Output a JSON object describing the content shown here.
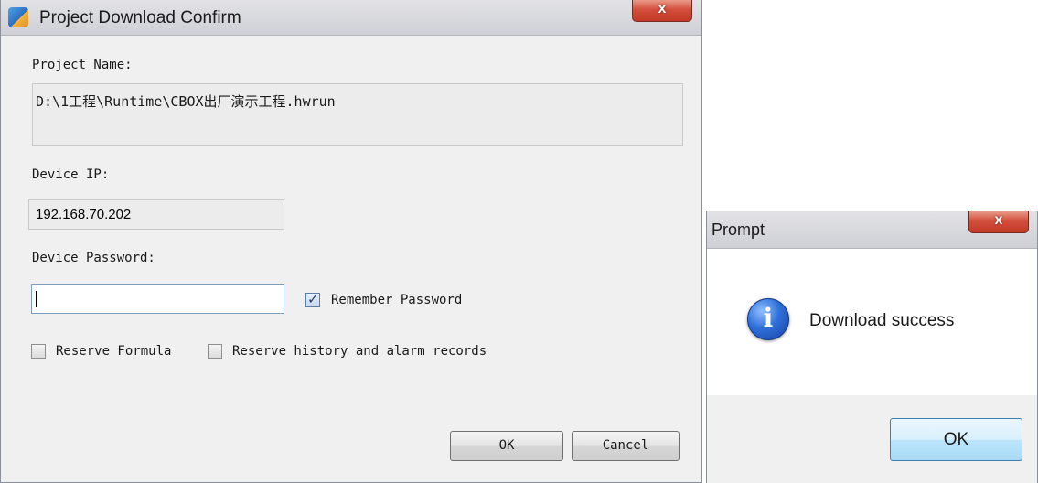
{
  "download_dialog": {
    "title": "Project Download Confirm",
    "close_label": "x",
    "project_name_label": "Project Name:",
    "project_name_value": "D:\\1工程\\Runtime\\CBOX出厂演示工程.hwrun",
    "device_ip_label": "Device IP:",
    "device_ip_value": "192.168.70.202",
    "device_password_label": "Device Password:",
    "device_password_value": "",
    "remember_password_label": "Remember Password",
    "remember_password_checked": true,
    "reserve_formula_label": "Reserve Formula",
    "reserve_formula_checked": false,
    "reserve_history_label": "Reserve history and alarm records",
    "reserve_history_checked": false,
    "ok_label": "OK",
    "cancel_label": "Cancel"
  },
  "prompt_dialog": {
    "title": "Prompt",
    "close_label": "x",
    "icon": "info-icon",
    "message": "Download success",
    "ok_label": "OK"
  }
}
